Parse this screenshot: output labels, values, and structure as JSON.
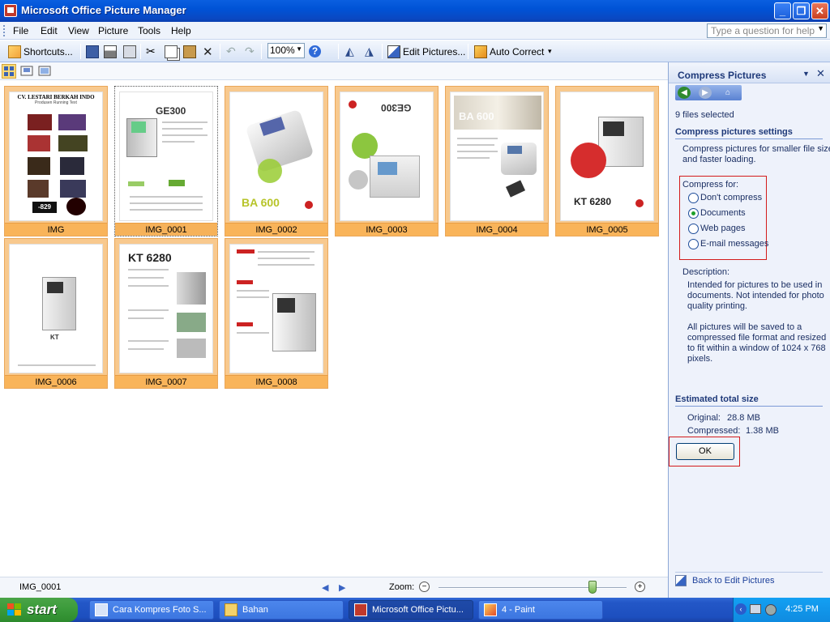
{
  "window": {
    "title": "Microsoft Office Picture Manager"
  },
  "menu": {
    "items": [
      "File",
      "Edit",
      "View",
      "Picture",
      "Tools",
      "Help"
    ],
    "help_placeholder": "Type a question for help"
  },
  "toolbar": {
    "shortcuts_label": "Shortcuts...",
    "zoom_value": "100%",
    "edit_pictures_label": "Edit Pictures...",
    "auto_correct_label": "Auto Correct"
  },
  "thumbnails": [
    {
      "name": "IMG",
      "selected": false
    },
    {
      "name": "IMG_0001",
      "selected": true
    },
    {
      "name": "IMG_0002",
      "selected": false
    },
    {
      "name": "IMG_0003",
      "selected": false
    },
    {
      "name": "IMG_0004",
      "selected": false
    },
    {
      "name": "IMG_0005",
      "selected": false
    },
    {
      "name": "IMG_0006",
      "selected": false
    },
    {
      "name": "IMG_0007",
      "selected": false
    },
    {
      "name": "IMG_0008",
      "selected": false
    }
  ],
  "thumb_text": {
    "img_title": "CV. LESTARI BERKAH INDO",
    "img_sub": "Produsen Running Text",
    "img_led": "-829",
    "ge300": "GE300",
    "ba600": "BA 600",
    "kt6280": "KT 6280"
  },
  "status": {
    "filename": "IMG_0001",
    "zoom_label": "Zoom:",
    "zoom_level": 0.82
  },
  "pane": {
    "title": "Compress Pictures",
    "files_selected": "9 files selected",
    "settings_heading": "Compress pictures settings",
    "intro_line1": "Compress pictures for smaller file size",
    "intro_line2": "and faster loading.",
    "compress_for": "Compress for:",
    "options": [
      {
        "label": "Don't compress",
        "checked": false
      },
      {
        "label": "Documents",
        "checked": true
      },
      {
        "label": "Web pages",
        "checked": false
      },
      {
        "label": "E-mail messages",
        "checked": false
      }
    ],
    "description_label": "Description:",
    "desc_lines": [
      "Intended for pictures to be used in",
      "documents. Not intended for photo",
      "quality printing."
    ],
    "desc2_lines": [
      "All pictures will be saved to a",
      "compressed file format and resized",
      "to fit within a window of 1024 x 768",
      "pixels."
    ],
    "estimate_heading": "Estimated total size",
    "original_label": "Original:",
    "original_value": "28.8 MB",
    "compressed_label": "Compressed:",
    "compressed_value": "1.38 MB",
    "ok_label": "OK",
    "back_label": "Back to Edit Pictures"
  },
  "taskbar": {
    "start_label": "start",
    "tasks": [
      {
        "label": "Cara Kompres Foto S...",
        "active": false
      },
      {
        "label": "Bahan",
        "active": false
      },
      {
        "label": "Microsoft Office Pictu...",
        "active": true
      },
      {
        "label": "4 - Paint",
        "active": false
      }
    ],
    "clock": "4:25 PM"
  },
  "colors": {
    "thumb_bg": "#f8c98e",
    "caption_bg": "#f9b45a",
    "pane_bg": "#eef2fb",
    "highlight_box": "#d31b1b"
  }
}
